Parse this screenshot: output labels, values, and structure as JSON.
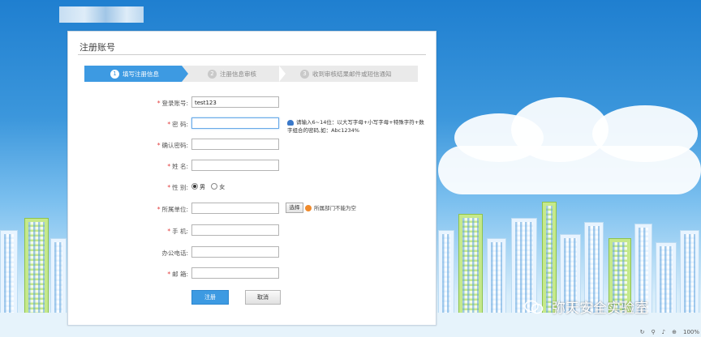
{
  "header": {
    "logo_text": ""
  },
  "form": {
    "title": "注册账号",
    "steps": [
      {
        "num": "1",
        "label": "填写注册信息"
      },
      {
        "num": "2",
        "label": "注册信息审核"
      },
      {
        "num": "3",
        "label": "收到审核结果邮件或短信通知"
      }
    ],
    "fields": {
      "login": {
        "label": "登录账号:",
        "value": "test123"
      },
      "password": {
        "label": "密 码:",
        "value": "",
        "hint": "请输入6~14位：以大写字母+小写字母+特殊字符+数字组合的密码,如：Abc1234%"
      },
      "confirm": {
        "label": "确认密码:",
        "value": ""
      },
      "name": {
        "label": "姓 名:",
        "value": ""
      },
      "gender": {
        "label": "性 别:",
        "options": [
          "男",
          "女"
        ],
        "selected": "男"
      },
      "unit": {
        "label": "所属单位:",
        "value": "",
        "button": "选择",
        "error": "所属部门不能为空"
      },
      "mobile": {
        "label": "手 机:",
        "value": ""
      },
      "office_phone": {
        "label": "办公电话:",
        "value": ""
      },
      "email": {
        "label": "邮 箱:",
        "value": ""
      }
    },
    "buttons": {
      "submit": "注册",
      "cancel": "取消"
    }
  },
  "watermark": {
    "text": "弥天安全实验室"
  },
  "statusbar": {
    "zoom": "100%"
  },
  "colors": {
    "accent": "#3d9ae2",
    "required": "#e23b3b",
    "warning": "#f08a2c"
  }
}
